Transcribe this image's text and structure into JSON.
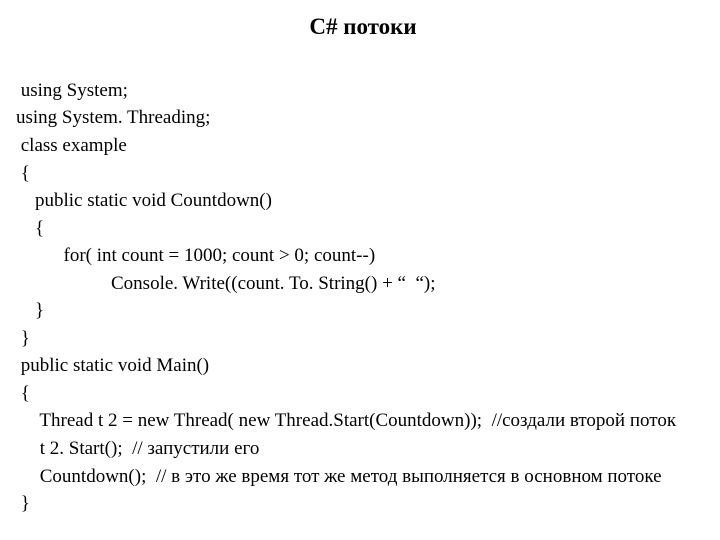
{
  "title": "C#   потоки",
  "lines": {
    "l1": " using System;",
    "l2": "using System. Threading;",
    "l3": " class example",
    "l4": " {",
    "l5": "    public static void Countdown()",
    "l6": "    {",
    "l7": "          for( int count = 1000; count > 0; count--)",
    "l8": "                    Console. Write((count. To. String() + “  “);",
    "l9": "    }",
    "l10": " }",
    "l11": " public static void Main()",
    "l12": " {",
    "l13": "     Thread t 2 = new Thread( new Thread.Start(Countdown));  //создали второй поток",
    "l14": "     t 2. Start();  // запустили его",
    "l15": "     Countdown();  // в это же время тот же метод выполняется в основном потоке",
    "l16": " }"
  }
}
